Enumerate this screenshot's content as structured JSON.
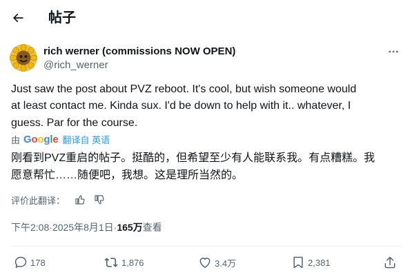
{
  "header": {
    "title": "帖子",
    "back_icon": "arrow-left-icon"
  },
  "author": {
    "name": "rich werner (commissions NOW OPEN)",
    "handle": "@rich_werner",
    "avatar_icon": "sunflower-avatar"
  },
  "tweet": {
    "line1": "Just saw the post about PVZ reboot. It's cool, but wish someone would",
    "line2": "at least contact me.  Kinda  sux. I'd be down to help with it.. whatever, I",
    "line3": "guess. Par for the course."
  },
  "translation": {
    "by_label": "由",
    "provider": "Google",
    "link_text": "翻译自 英语",
    "line1": "刚看到PVZ重启的帖子。挺酷的，但希望至少有人能联系我。有点糟糕。我",
    "line2": "愿意帮忙……随便吧，我想。这是理所当然的。"
  },
  "rate": {
    "label": "评价此翻译："
  },
  "meta": {
    "time": "下午2:08",
    "sep1": " · ",
    "date": "2025年8月1日",
    "sep2": " · ",
    "views_count": "165万",
    "views_label": " 查看"
  },
  "actions": {
    "reply_count": "178",
    "retweet_count": "1,876",
    "like_count": "3.4万",
    "bookmark_count": "2,381"
  },
  "colors": {
    "text": "#0f1419",
    "secondary": "#536471",
    "link": "#1d9bf0",
    "divider": "#eff3f4"
  }
}
